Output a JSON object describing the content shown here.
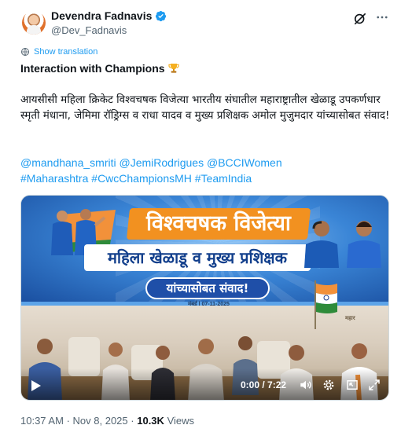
{
  "author": {
    "display_name": "Devendra Fadnavis",
    "handle": "@Dev_Fadnavis",
    "verified": true,
    "verified_color": "#1d9bf0"
  },
  "translation": {
    "label": "Show translation",
    "icon": "globe-icon"
  },
  "tweet": {
    "title": "Interaction with Champions",
    "title_emoji": "trophy-icon",
    "body": "आयसीसी महिला क्रिकेट विश्वचषक विजेत्या भारतीय संघातील महाराष्ट्रातील खेळाडू उपकर्णधार स्मृती मंधाना, जेमिमा रॉड्रिग्स व राधा यादव व मुख्य प्रशिक्षक अमोल मुजुमदार यांच्यासोबत संवाद!",
    "mentions": [
      "@mandhana_smriti",
      "@JemiRodrigues",
      "@BCCIWomen"
    ],
    "hashtags": [
      "#Maharashtra",
      "#CwcChampionsMH",
      "#TeamIndia"
    ]
  },
  "media": {
    "banner_line1": "विश्वचषक विजेत्या",
    "banner_line2": "महिला खेळाडू व मुख्य प्रशिक्षक",
    "banner_line3": "यांच्यासोबत संवाद!",
    "banner_date": "मुंबई | 07-11-2025",
    "wall_text": "महार",
    "video_time": "0:00 / 7:22"
  },
  "footer": {
    "time": "10:37 AM",
    "separator": "·",
    "date": "Nov 8, 2025",
    "views_count": "10.3K",
    "views_label": "Views"
  },
  "colors": {
    "link": "#1d9bf0",
    "text": "#0f1419",
    "muted": "#536471",
    "banner_orange": "#f29120",
    "banner_blue": "#123f8c"
  }
}
